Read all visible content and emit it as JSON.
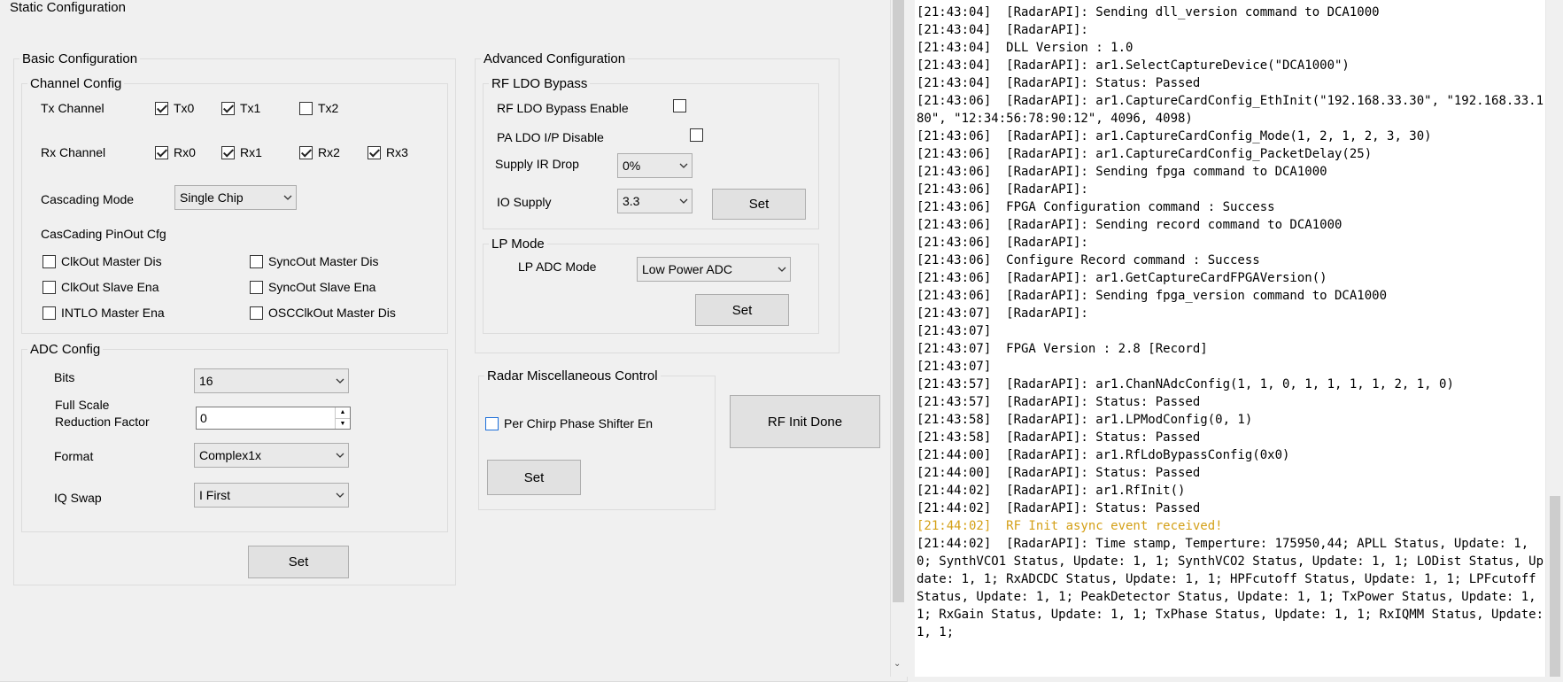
{
  "static_config": {
    "title": "Static Configuration"
  },
  "basic": {
    "title": "Basic Configuration",
    "channel_config": {
      "title": "Channel Config",
      "tx_label": "Tx Channel",
      "tx": [
        {
          "label": "Tx0",
          "checked": true
        },
        {
          "label": "Tx1",
          "checked": true
        },
        {
          "label": "Tx2",
          "checked": false
        }
      ],
      "rx_label": "Rx Channel",
      "rx": [
        {
          "label": "Rx0",
          "checked": true
        },
        {
          "label": "Rx1",
          "checked": true
        },
        {
          "label": "Rx2",
          "checked": true
        },
        {
          "label": "Rx3",
          "checked": true
        }
      ],
      "cascading_mode_label": "Cascading Mode",
      "cascading_mode_value": "Single Chip",
      "pinout_label": "CasCading PinOut Cfg",
      "pinout": [
        {
          "label": "ClkOut Master Dis",
          "checked": false
        },
        {
          "label": "SyncOut Master Dis",
          "checked": false
        },
        {
          "label": "ClkOut Slave Ena",
          "checked": false
        },
        {
          "label": "SyncOut Slave Ena",
          "checked": false
        },
        {
          "label": "INTLO Master Ena",
          "checked": false
        },
        {
          "label": "OSCClkOut Master Dis",
          "checked": false
        }
      ]
    },
    "adc_config": {
      "title": "ADC Config",
      "bits_label": "Bits",
      "bits_value": "16",
      "full_scale_label_1": "Full Scale",
      "full_scale_label_2": "Reduction Factor",
      "full_scale_value": "0",
      "format_label": "Format",
      "format_value": "Complex1x",
      "iq_swap_label": "IQ Swap",
      "iq_swap_value": "I First"
    },
    "set_label": "Set"
  },
  "advanced": {
    "title": "Advanced Configuration",
    "rf_ldo": {
      "title": "RF LDO Bypass",
      "enable_label": "RF LDO Bypass Enable",
      "enable_checked": false,
      "paldo_label": "PA LDO I/P Disable",
      "paldo_checked": false,
      "supply_ir_label": "Supply IR Drop",
      "supply_ir_value": "0%",
      "io_supply_label": "IO Supply",
      "io_supply_value": "3.3",
      "set_label": "Set"
    },
    "lp_mode": {
      "title": "LP Mode",
      "adc_mode_label": "LP ADC Mode",
      "adc_mode_value": "Low Power ADC",
      "set_label": "Set"
    }
  },
  "radar_misc": {
    "title": "Radar Miscellaneous Control",
    "phase_shifter_label": "Per Chirp Phase Shifter En",
    "phase_shifter_checked": false,
    "set_label": "Set"
  },
  "rf_init_done_label": "RF Init Done",
  "log": {
    "lines": [
      {
        "text": "[21:43:04]  [RadarAPI]: Sending dll_version command to DCA1000"
      },
      {
        "text": "[21:43:04]  [RadarAPI]:"
      },
      {
        "text": "[21:43:04]  DLL Version : 1.0"
      },
      {
        "text": "[21:43:04]  [RadarAPI]: ar1.SelectCaptureDevice(\"DCA1000\")"
      },
      {
        "text": "[21:43:04]  [RadarAPI]: Status: Passed"
      },
      {
        "text": "[21:43:06]  [RadarAPI]: ar1.CaptureCardConfig_EthInit(\"192.168.33.30\", \"192.168.33.180\", \"12:34:56:78:90:12\", 4096, 4098)"
      },
      {
        "text": "[21:43:06]  [RadarAPI]: ar1.CaptureCardConfig_Mode(1, 2, 1, 2, 3, 30)"
      },
      {
        "text": "[21:43:06]  [RadarAPI]: ar1.CaptureCardConfig_PacketDelay(25)"
      },
      {
        "text": "[21:43:06]  [RadarAPI]: Sending fpga command to DCA1000"
      },
      {
        "text": "[21:43:06]  [RadarAPI]:"
      },
      {
        "text": "[21:43:06]  FPGA Configuration command : Success"
      },
      {
        "text": "[21:43:06]  [RadarAPI]: Sending record command to DCA1000"
      },
      {
        "text": "[21:43:06]  [RadarAPI]:"
      },
      {
        "text": "[21:43:06]  Configure Record command : Success"
      },
      {
        "text": "[21:43:06]  [RadarAPI]: ar1.GetCaptureCardFPGAVersion()"
      },
      {
        "text": "[21:43:06]  [RadarAPI]: Sending fpga_version command to DCA1000"
      },
      {
        "text": "[21:43:07]  [RadarAPI]:"
      },
      {
        "text": "[21:43:07]"
      },
      {
        "text": "[21:43:07]  FPGA Version : 2.8 [Record]"
      },
      {
        "text": "[21:43:07]"
      },
      {
        "text": "[21:43:57]  [RadarAPI]: ar1.ChanNAdcConfig(1, 1, 0, 1, 1, 1, 1, 2, 1, 0)"
      },
      {
        "text": "[21:43:57]  [RadarAPI]: Status: Passed"
      },
      {
        "text": "[21:43:58]  [RadarAPI]: ar1.LPModConfig(0, 1)"
      },
      {
        "text": "[21:43:58]  [RadarAPI]: Status: Passed"
      },
      {
        "text": "[21:44:00]  [RadarAPI]: ar1.RfLdoBypassConfig(0x0)"
      },
      {
        "text": "[21:44:00]  [RadarAPI]: Status: Passed"
      },
      {
        "text": "[21:44:02]  [RadarAPI]: ar1.RfInit()"
      },
      {
        "text": "[21:44:02]  [RadarAPI]: Status: Passed"
      },
      {
        "text": "[21:44:02]  RF Init async event received!",
        "highlight": true,
        "color": "#d4a017"
      },
      {
        "text": "[21:44:02]  [RadarAPI]: Time stamp, Temperture: 175950,44; APLL Status, Update: 1, 0; SynthVCO1 Status, Update: 1, 1; SynthVCO2 Status, Update: 1, 1; LODist Status, Update: 1, 1; RxADCDC Status, Update: 1, 1; HPFcutoff Status, Update: 1, 1; LPFcutoff Status, Update: 1, 1; PeakDetector Status, Update: 1, 1; TxPower Status, Update: 1, 1; RxGain Status, Update: 1, 1; TxPhase Status, Update: 1, 1; RxIQMM Status, Update: 1, 1;"
      }
    ]
  }
}
